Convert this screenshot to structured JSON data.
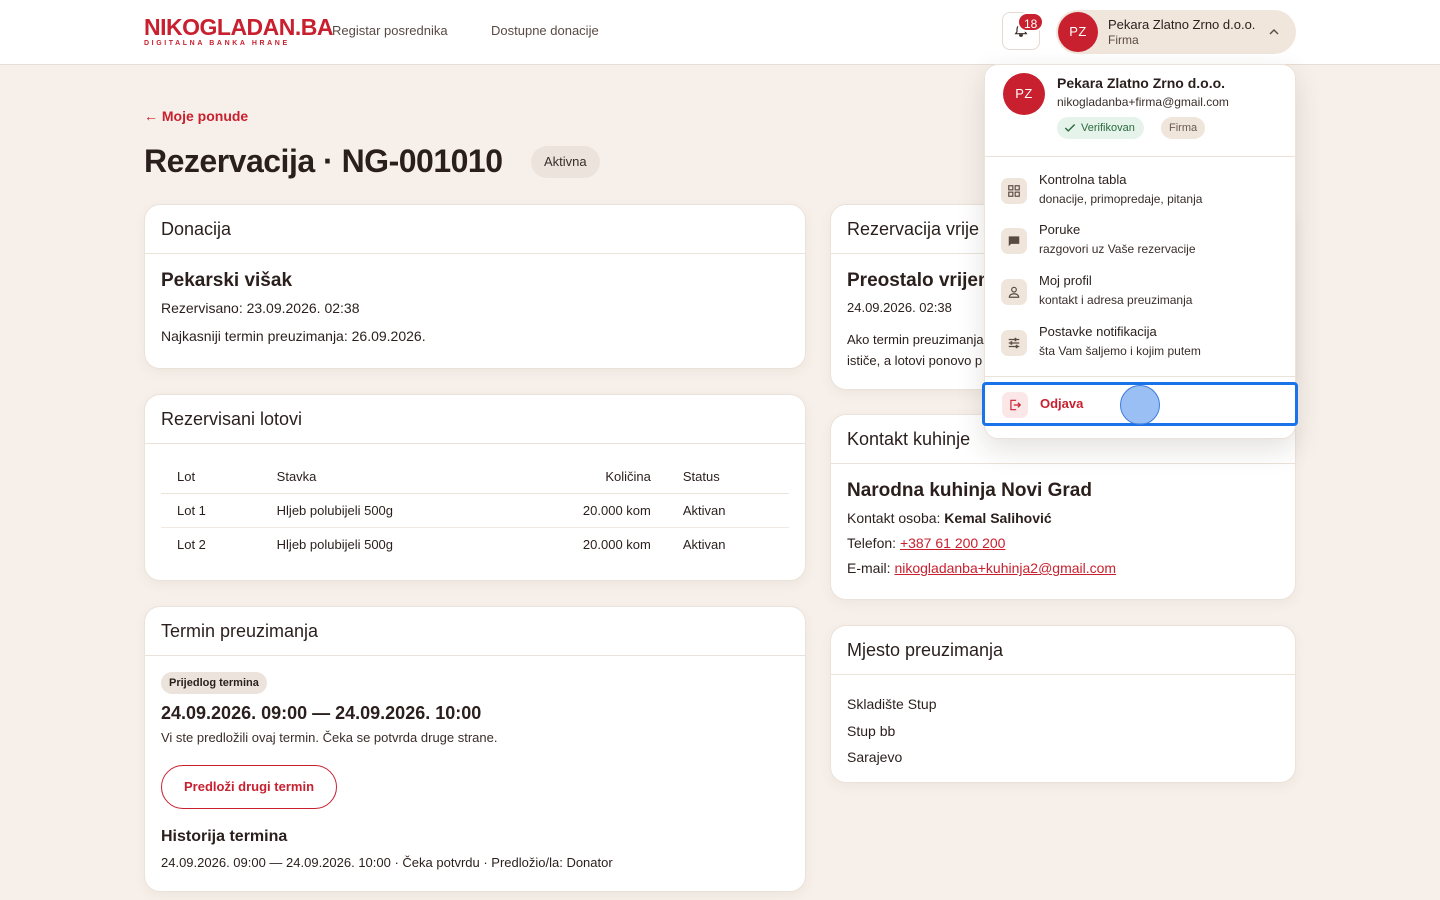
{
  "header": {
    "logo_main": "NIKOGLADAN.BA",
    "logo_sub": "DIGITALNA BANKA HRANE",
    "nav": [
      "Registar posrednika",
      "Dostupne donacije"
    ],
    "notifications_count": "18",
    "user": {
      "initials": "PZ",
      "name": "Pekara Zlatno Zrno d.o.o.",
      "role": "Firma"
    }
  },
  "page": {
    "back_label": "← Moje ponude",
    "title": "Rezervacija · NG-001010",
    "status": "Aktivna"
  },
  "donation": {
    "header": "Donacija",
    "name": "Pekarski višak",
    "reserved": "Rezervisano: 23.09.2026. 02:38",
    "latest_pickup": "Najkasniji termin preuzimanja: 26.09.2026."
  },
  "lots": {
    "header": "Rezervisani lotovi",
    "columns": [
      "Lot",
      "Stavka",
      "Količina",
      "Status"
    ],
    "rows": [
      [
        "Lot 1",
        "Hljeb polubijeli 500g",
        "20.000 kom",
        "Aktivan"
      ],
      [
        "Lot 2",
        "Hljeb polubijeli 500g",
        "20.000 kom",
        "Aktivan"
      ]
    ]
  },
  "pickup_term": {
    "header": "Termin preuzimanja",
    "tag": "Prijedlog termina",
    "time": "24.09.2026. 09:00 — 24.09.2026. 10:00",
    "note": "Vi ste predložili ovaj termin. Čeka se potvrda druge strane.",
    "button": "Predloži drugi termin",
    "history_title": "Historija termina",
    "history_line": "24.09.2026. 09:00 — 24.09.2026. 10:00 · Čeka potvrdu · Predložio/la: Donator"
  },
  "reservation_time": {
    "header": "Rezervacija vrije",
    "title": "Preostalo vrijem",
    "date": "24.09.2026. 02:38",
    "text1": "Ako termin preuzimanja",
    "text2": "ističe, a lotovi ponovo p"
  },
  "kitchen": {
    "header": "Kontakt kuhinje",
    "name": "Narodna kuhinja Novi Grad",
    "contact_label": "Kontakt osoba: ",
    "contact_name": "Kemal Salihović",
    "phone_label": "Telefon: ",
    "phone": "+387 61 200 200",
    "email_label": "E-mail: ",
    "email": "nikogladanba+kuhinja2@gmail.com"
  },
  "pickup_place": {
    "header": "Mjesto preuzimanja",
    "lines": [
      "Skladište Stup",
      "Stup bb",
      "Sarajevo"
    ]
  },
  "dropdown": {
    "initials": "PZ",
    "name": "Pekara Zlatno Zrno d.o.o.",
    "email": "nikogladanba+firma@gmail.com",
    "verified": "Verifikovan",
    "role": "Firma",
    "items": [
      {
        "icon": "dashboard-icon",
        "label": "Kontrolna tabla",
        "sub": "donacije, primopredaje, pitanja"
      },
      {
        "icon": "message-icon",
        "label": "Poruke",
        "sub": "razgovori uz Vaše rezervacije"
      },
      {
        "icon": "person-icon",
        "label": "Moj profil",
        "sub": "kontakt i adresa preuzimanja"
      },
      {
        "icon": "sliders-icon",
        "label": "Postavke notifikacija",
        "sub": "šta Vam šaljemo i kojim putem"
      }
    ],
    "logout": {
      "icon": "logout-icon",
      "label": "Odjava"
    }
  },
  "colors": {
    "brand": "#c8202f",
    "background": "#f7f0ea",
    "focus_outline": "#1a73e8"
  }
}
